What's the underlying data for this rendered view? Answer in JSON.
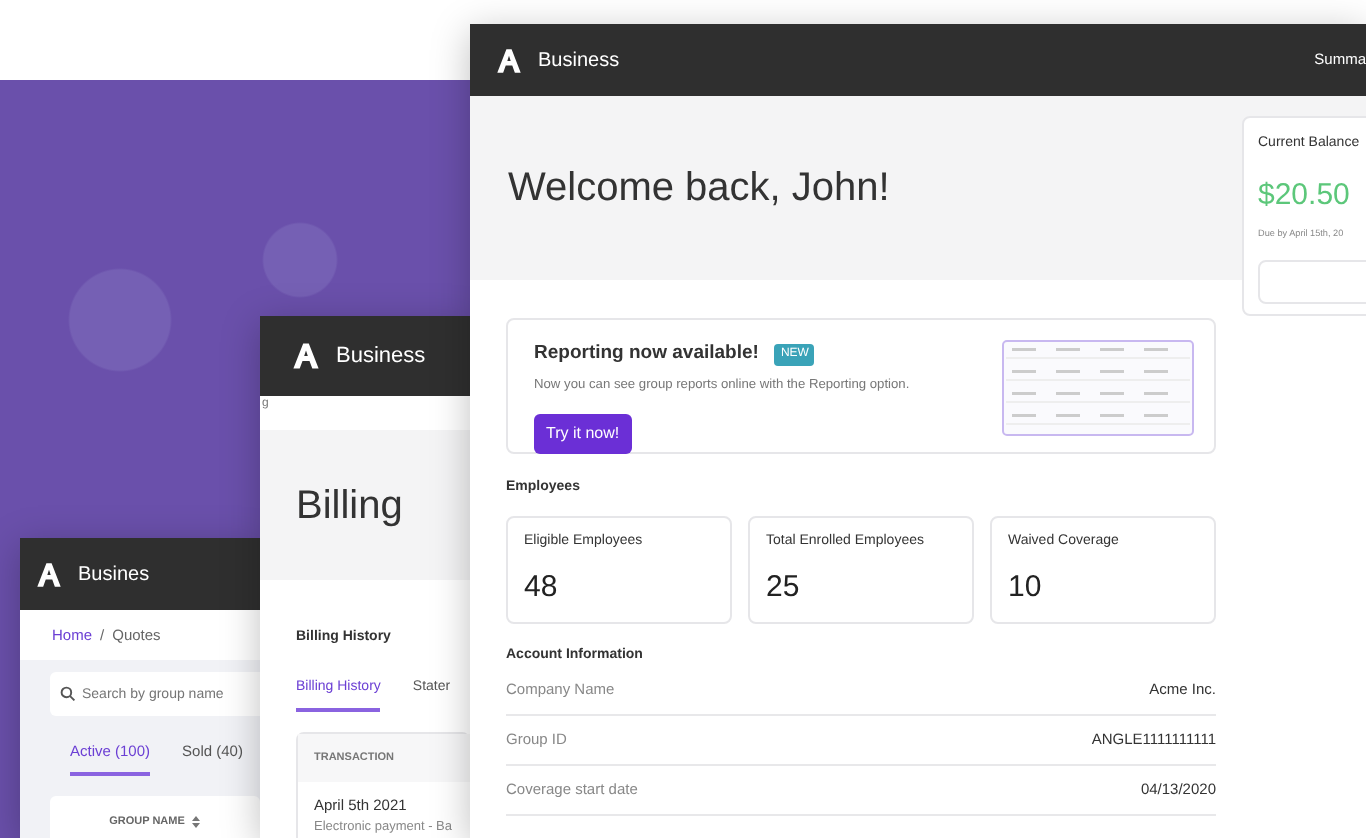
{
  "quotes_window": {
    "app_name": "Busines",
    "breadcrumb": [
      "Home",
      "Quotes"
    ],
    "breadcrumb_separator": "/",
    "search": {
      "placeholder": "Search by group name"
    },
    "tabs": [
      {
        "label": "Active (100)",
        "selected": true
      },
      {
        "label": "Sold (40)",
        "selected": false
      }
    ],
    "table": {
      "columns": [
        "GROUP NAME"
      ]
    }
  },
  "billing_window": {
    "app_name": "Business",
    "breadcrumb_fragment": "g",
    "title": "Billing",
    "section_title": "Billing History",
    "tabs": [
      {
        "label": "Billing History",
        "selected": true
      },
      {
        "label": "Stater",
        "selected": false
      }
    ],
    "table": {
      "columns": [
        "TRANSACTION"
      ],
      "rows": [
        {
          "date": "April 5th 2021",
          "description": "Electronic payment - Ba"
        }
      ]
    }
  },
  "dashboard_window": {
    "app_name": "Business",
    "nav": [
      "Summa"
    ],
    "greeting": "Welcome back, John!",
    "balance": {
      "label": "Current Balance",
      "amount": "$20.50",
      "due": "Due by April 15th, 20"
    },
    "announcement": {
      "title": "Reporting now available!",
      "badge": "NEW",
      "text": "Now you can see group reports online with the Reporting option.",
      "button": "Try it now!"
    },
    "employees": {
      "title": "Employees",
      "stats": [
        {
          "label": "Eligible Employees",
          "value": "48"
        },
        {
          "label": "Total Enrolled Employees",
          "value": "25"
        },
        {
          "label": "Waived Coverage",
          "value": "10"
        }
      ]
    },
    "account": {
      "title": "Account Information",
      "rows": [
        {
          "label": "Company Name",
          "value": "Acme Inc."
        },
        {
          "label": "Group ID",
          "value": "ANGLE1111111111"
        },
        {
          "label": "Coverage start date",
          "value": "04/13/2020"
        }
      ]
    }
  }
}
